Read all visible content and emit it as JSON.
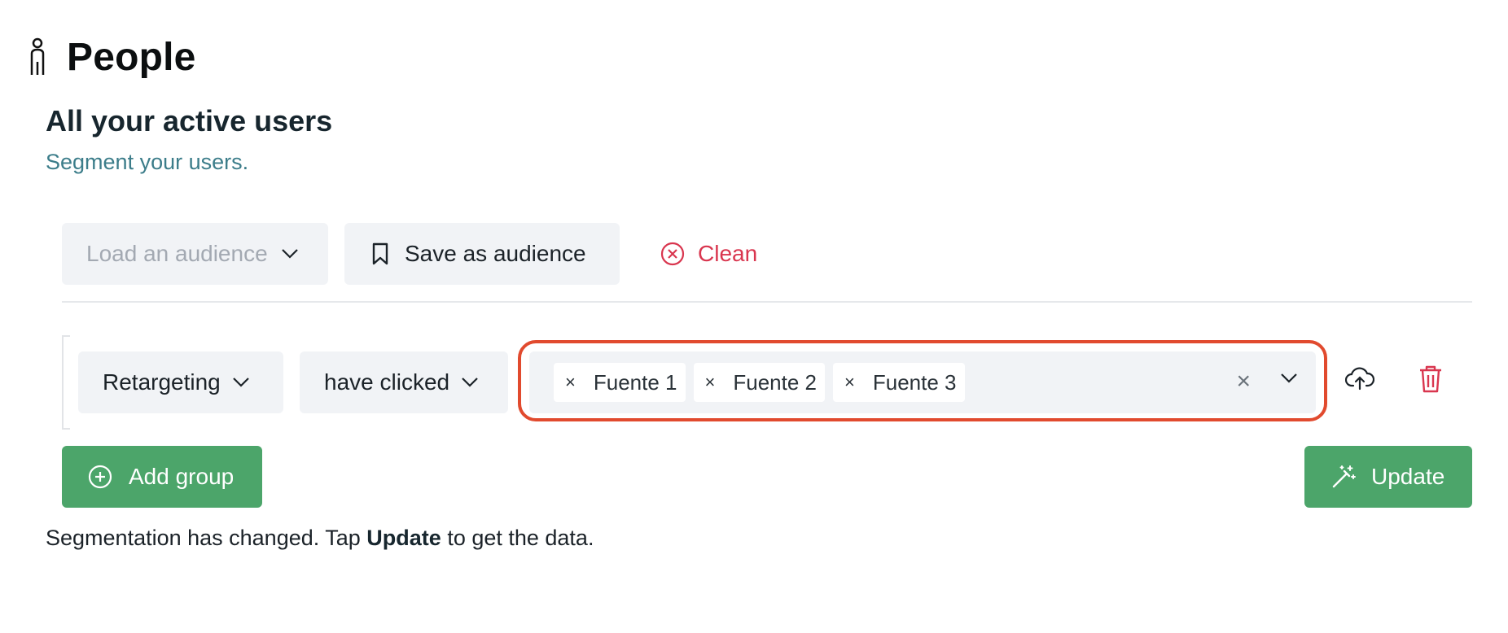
{
  "header": {
    "title": "People",
    "icon": "person-icon"
  },
  "section": {
    "title": "All your active users",
    "subtitle": "Segment your users."
  },
  "toolbar": {
    "load_audience_placeholder": "Load an audience",
    "save_audience_label": "Save as audience",
    "clean_label": "Clean"
  },
  "filter": {
    "field": "Retargeting",
    "operator": "have clicked",
    "values": [
      "Fuente 1",
      "Fuente 2",
      "Fuente 3"
    ]
  },
  "actions": {
    "add_group_label": "Add group",
    "update_label": "Update"
  },
  "status": {
    "prefix": "Segmentation has changed. Tap ",
    "bold": "Update",
    "suffix": " to get the data."
  },
  "colors": {
    "accent": "#4ca56a",
    "danger": "#d9364f",
    "highlight": "#e14a2e",
    "subtitle": "#3c7d8a"
  }
}
